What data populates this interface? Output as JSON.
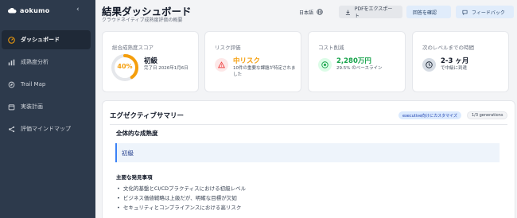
{
  "sidebar": {
    "brand": "aokumo",
    "items": [
      {
        "label": "ダッシュボード",
        "icon": "dashboard-icon",
        "active": true
      },
      {
        "label": "成熟度分析",
        "icon": "bar-chart-icon",
        "active": false
      },
      {
        "label": "Trail Map",
        "icon": "map-icon",
        "active": false
      },
      {
        "label": "実装計画",
        "icon": "calendar-icon",
        "active": false
      },
      {
        "label": "評価マインドマップ",
        "icon": "mindmap-icon",
        "active": false
      }
    ]
  },
  "header": {
    "title": "結果ダッシュボード",
    "subtitle": "クラウドネイティブ成熟度評価の概要",
    "language": "日本語",
    "export_label": "PDFをエクスポート",
    "confirm_label": "回答を確認",
    "feedback_label": "フィードバック"
  },
  "cards": {
    "maturity": {
      "title": "総合成熟度スコア",
      "percent": "40%",
      "percent_value": 40,
      "level": "初級",
      "detail": "完了日 2026年1月6日"
    },
    "risk": {
      "title": "リスク評価",
      "value": "中リスク",
      "detail": "10件の重要な課題が特定されました"
    },
    "cost": {
      "title": "コスト削減",
      "value": "2,280万円",
      "detail": "29.5% のベースライン"
    },
    "time": {
      "title": "次のレベルまでの時間",
      "value": "2-3 ヶ月",
      "detail": "で中級に到達"
    }
  },
  "summary": {
    "title": "エグゼクティブサマリー",
    "badge_custom": "executive向けにカスタマイズ",
    "badge_generations": "1/3 generations",
    "maturity_heading": "全体的な成熟度",
    "maturity_value": "初級",
    "findings_heading": "主要な発見事項",
    "findings": [
      "文化的基盤とCI/CDプラクティスにおける初級レベル",
      "ビジネス価値戦略は上級だが、明確な目標が欠如",
      "セキュリティとコンプライアンスにおける高リスク"
    ]
  },
  "colors": {
    "sidebar_bg": "#2d3a4c",
    "accent_orange": "#f59e0b",
    "accent_green": "#16a34a",
    "risk_red": "#ef4444",
    "accent_blue": "#3b82f6"
  }
}
